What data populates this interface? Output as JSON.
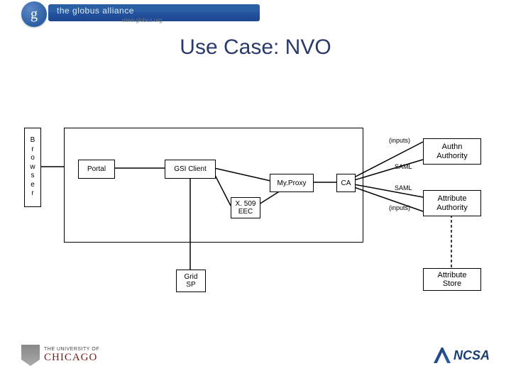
{
  "header": {
    "brand": "the globus alliance",
    "url": "www.globus.org",
    "logo_letter": "g"
  },
  "title": "Use Case: NVO",
  "nodes": {
    "browser": "Browser",
    "portal": "Portal",
    "gsi": "GSI Client",
    "myproxy": "My.Proxy",
    "x509": "X. 509\nEEC",
    "ca": "CA",
    "authn": "Authn\nAuthority",
    "attr_auth": "Attribute\nAuthority",
    "grid_sp": "Grid\nSP",
    "attr_store": "Attribute\nStore"
  },
  "labels": {
    "inputs1": "(inputs)",
    "saml1": "SAML",
    "saml2": "SAML",
    "inputs2": "(inputs)"
  },
  "footer": {
    "uchicago_top": "THE UNIVERSITY OF",
    "uchicago": "CHICAGO",
    "ncsa": "NCSA"
  },
  "chart_data": {
    "type": "diagram",
    "title": "Use Case: NVO",
    "nodes": [
      {
        "id": "browser",
        "label": "Browser"
      },
      {
        "id": "portal",
        "label": "Portal",
        "in_container": true
      },
      {
        "id": "gsi",
        "label": "GSI Client",
        "in_container": true
      },
      {
        "id": "myproxy",
        "label": "My.Proxy",
        "in_container": true
      },
      {
        "id": "x509",
        "label": "X.509 EEC",
        "in_container": true
      },
      {
        "id": "ca",
        "label": "CA",
        "in_container": true
      },
      {
        "id": "authn",
        "label": "Authn Authority"
      },
      {
        "id": "attr_auth",
        "label": "Attribute Authority"
      },
      {
        "id": "grid_sp",
        "label": "Grid SP"
      },
      {
        "id": "attr_store",
        "label": "Attribute Store"
      }
    ],
    "edges": [
      {
        "from": "browser",
        "to": "portal",
        "style": "solid"
      },
      {
        "from": "portal",
        "to": "gsi",
        "style": "solid"
      },
      {
        "from": "gsi",
        "to": "myproxy",
        "style": "solid"
      },
      {
        "from": "gsi",
        "to": "x509",
        "style": "solid"
      },
      {
        "from": "x509",
        "to": "myproxy",
        "style": "solid"
      },
      {
        "from": "myproxy",
        "to": "ca",
        "style": "solid"
      },
      {
        "from": "ca",
        "to": "authn",
        "style": "solid",
        "label": "(inputs)"
      },
      {
        "from": "ca",
        "to": "authn",
        "style": "solid",
        "label": "SAML"
      },
      {
        "from": "ca",
        "to": "attr_auth",
        "style": "solid",
        "label": "SAML"
      },
      {
        "from": "ca",
        "to": "attr_auth",
        "style": "solid",
        "label": "(inputs)"
      },
      {
        "from": "gsi",
        "to": "grid_sp",
        "style": "solid"
      },
      {
        "from": "attr_auth",
        "to": "attr_store",
        "style": "dashed"
      }
    ]
  }
}
